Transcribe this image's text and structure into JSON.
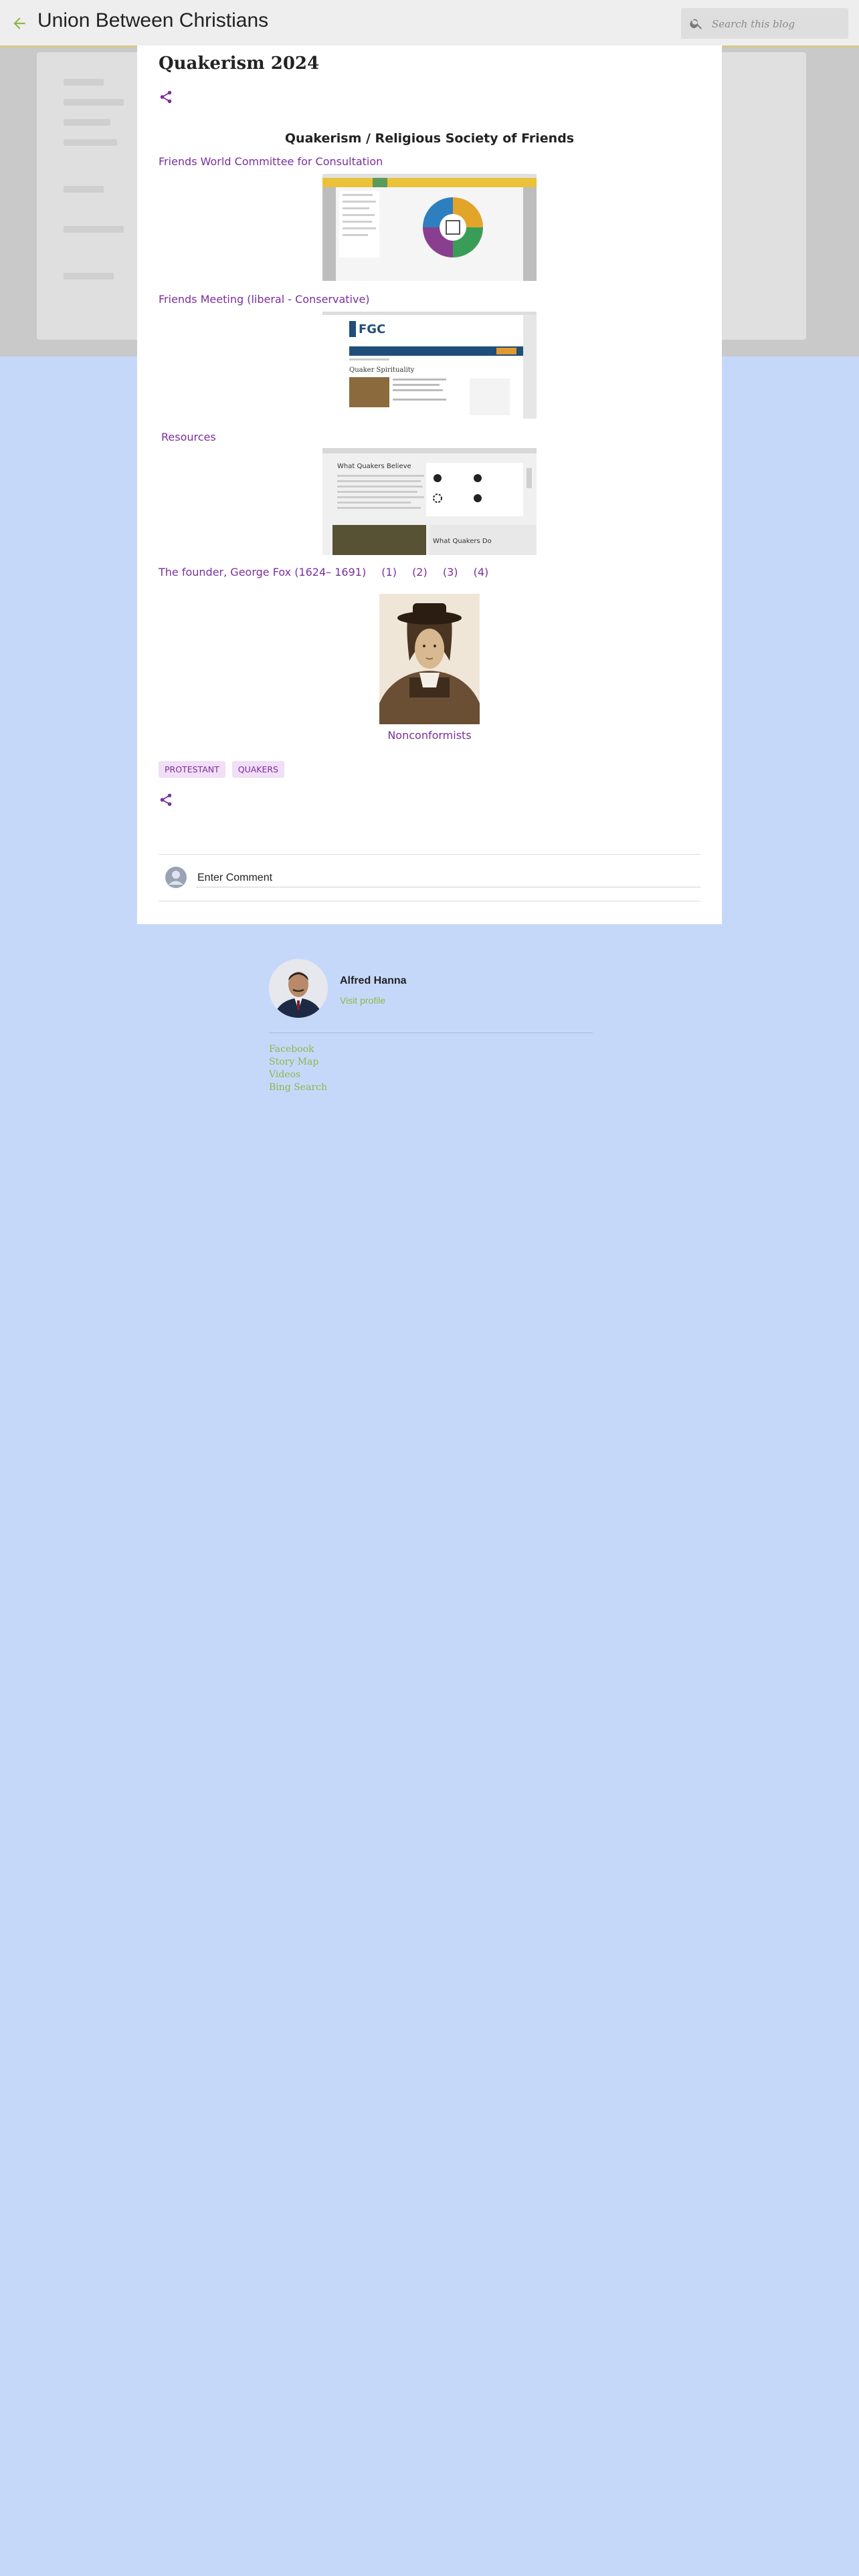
{
  "header": {
    "blog_title": "Union Between Christians",
    "search_placeholder": "Search this blog"
  },
  "post": {
    "title": "Quakerism 2024",
    "section_heading": "Quakerism / Religious Society of Friends",
    "links": {
      "fwcc": "Friends World Committee for Consultation",
      "meeting": "Friends Meeting (liberal - Conservative)",
      "resources": "Resources",
      "founder": "The founder, George Fox (1624– 1691)",
      "refs": [
        "(1)",
        "(2)",
        "(3)",
        "(4)"
      ],
      "nonconformists": "Nonconformists"
    },
    "screenshot_texts": {
      "fgc_logo": "FGC",
      "fgc_heading": "Quaker Spirituality",
      "resources_heading": "What Quakers Believe",
      "resources_sub": "What Quakers Do"
    },
    "labels": [
      "PROTESTANT",
      "QUAKERS"
    ],
    "comment_placeholder": "Enter Comment"
  },
  "profile": {
    "name": "Alfred Hanna",
    "visit": "Visit profile",
    "links": [
      "Facebook",
      "Story Map",
      "Videos",
      "Bing Search"
    ]
  },
  "colors": {
    "page_background": "#c6d8fa",
    "link": "#7b2f9c",
    "accent_green": "#8bb94a",
    "tag_background": "#f1def7"
  }
}
